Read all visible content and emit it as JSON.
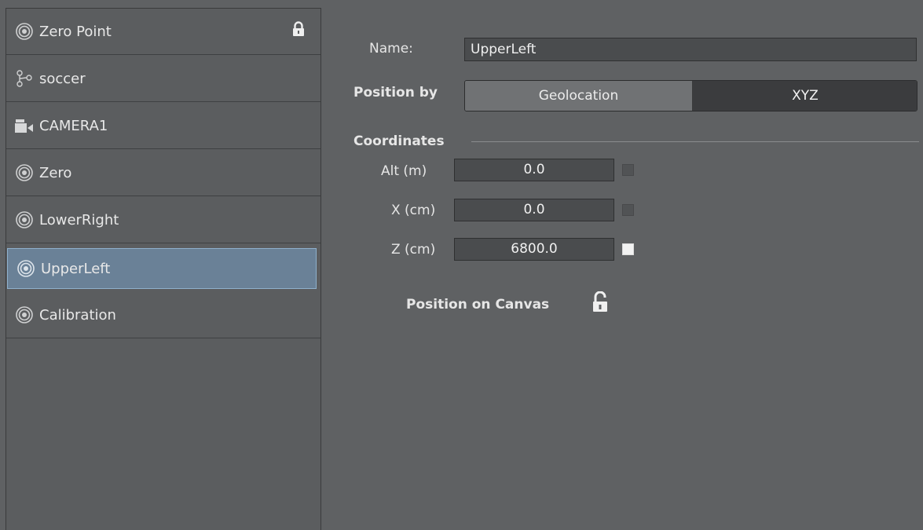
{
  "tree": {
    "items": [
      {
        "label": "Zero Point",
        "icon": "target-icon",
        "locked": true
      },
      {
        "label": "soccer",
        "icon": "branch-icon"
      },
      {
        "label": "CAMERA1",
        "icon": "camera-icon"
      },
      {
        "label": "Zero",
        "icon": "target-icon"
      },
      {
        "label": "LowerRight",
        "icon": "target-icon"
      },
      {
        "label": "UpperLeft",
        "icon": "target-icon",
        "selected": true
      },
      {
        "label": "Calibration",
        "icon": "target-icon"
      }
    ]
  },
  "props": {
    "name_label": "Name:",
    "name_value": "UpperLeft",
    "position_by_label": "Position by",
    "position_by_options": [
      "Geolocation",
      "XYZ"
    ],
    "position_by_selected": "XYZ",
    "coordinates_label": "Coordinates",
    "alt_label": "Alt  (m)",
    "alt_value": "0.0",
    "alt_checked": false,
    "x_label": "X (cm)",
    "x_value": "0.0",
    "x_checked": false,
    "z_label": "Z (cm)",
    "z_value": "6800.0",
    "z_checked": true,
    "position_on_canvas_label": "Position on Canvas",
    "canvas_lock_icon": "unlocked-padlock-icon"
  },
  "colors": {
    "background": "#5f6163",
    "selection": "#6a8197",
    "field": "#4a4c4e"
  }
}
